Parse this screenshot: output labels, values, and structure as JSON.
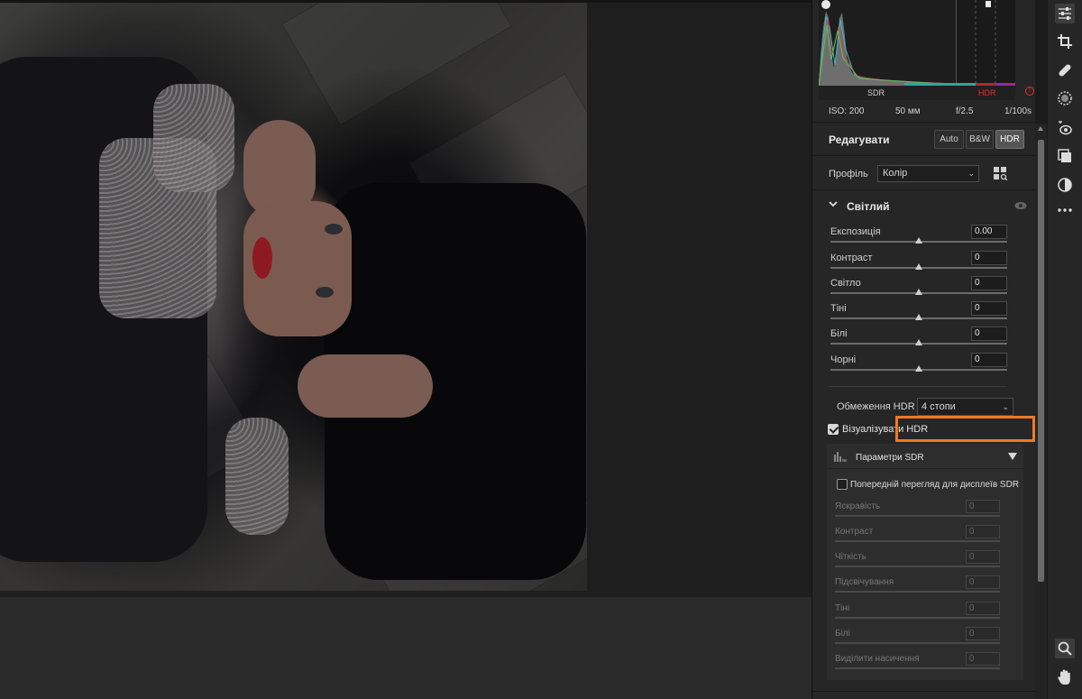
{
  "histogram": {
    "sdr_label": "SDR",
    "hdr_label": "HDR",
    "warning_icon": "hdr-clipping-warning-icon"
  },
  "exif": {
    "iso": "ISO: 200",
    "focal": "50 мм",
    "aperture": "f/2.5",
    "shutter": "1/100s"
  },
  "edit": {
    "title": "Редагувати",
    "buttons": [
      "Auto",
      "B&W",
      "HDR"
    ],
    "active": "HDR"
  },
  "profile": {
    "label": "Профіль",
    "value": "Колір"
  },
  "light": {
    "title": "Світлий",
    "sliders": [
      {
        "label": "Експозиція",
        "value": "0.00",
        "position": 0.5
      },
      {
        "label": "Контраст",
        "value": "0",
        "position": 0.5
      },
      {
        "label": "Світло",
        "value": "0",
        "position": 0.5
      },
      {
        "label": "Тіні",
        "value": "0",
        "position": 0.5
      },
      {
        "label": "Білі",
        "value": "0",
        "position": 0.5
      },
      {
        "label": "Чорні",
        "value": "0",
        "position": 0.5
      }
    ]
  },
  "hdr_limit": {
    "label": "Обмеження HDR",
    "value": "4 стопи"
  },
  "visualize_hdr": {
    "label": "Візуалізувати HDR",
    "checked": true
  },
  "sdr_settings": {
    "title": "Параметри SDR",
    "preview_label": "Попередній перегляд для дисплеїв SDR",
    "preview_checked": false,
    "sliders": [
      {
        "label": "Яскравість",
        "value": "0"
      },
      {
        "label": "Контраст",
        "value": "0"
      },
      {
        "label": "Чіткість",
        "value": "0"
      },
      {
        "label": "Підсвічування",
        "value": "0"
      },
      {
        "label": "Тіні",
        "value": "0"
      },
      {
        "label": "Білі",
        "value": "0"
      },
      {
        "label": "Виділити насичення",
        "value": "0"
      }
    ]
  },
  "colors": {
    "highlight": "#f07a21",
    "hdr_red": "#e0312c"
  },
  "toolbar": [
    "edit-sliders-icon",
    "crop-icon",
    "healing-icon",
    "mask-icon",
    "red-eye-icon",
    "presets-icon",
    "snapshot-icon",
    "more-icon",
    "zoom-icon",
    "hand-icon"
  ]
}
